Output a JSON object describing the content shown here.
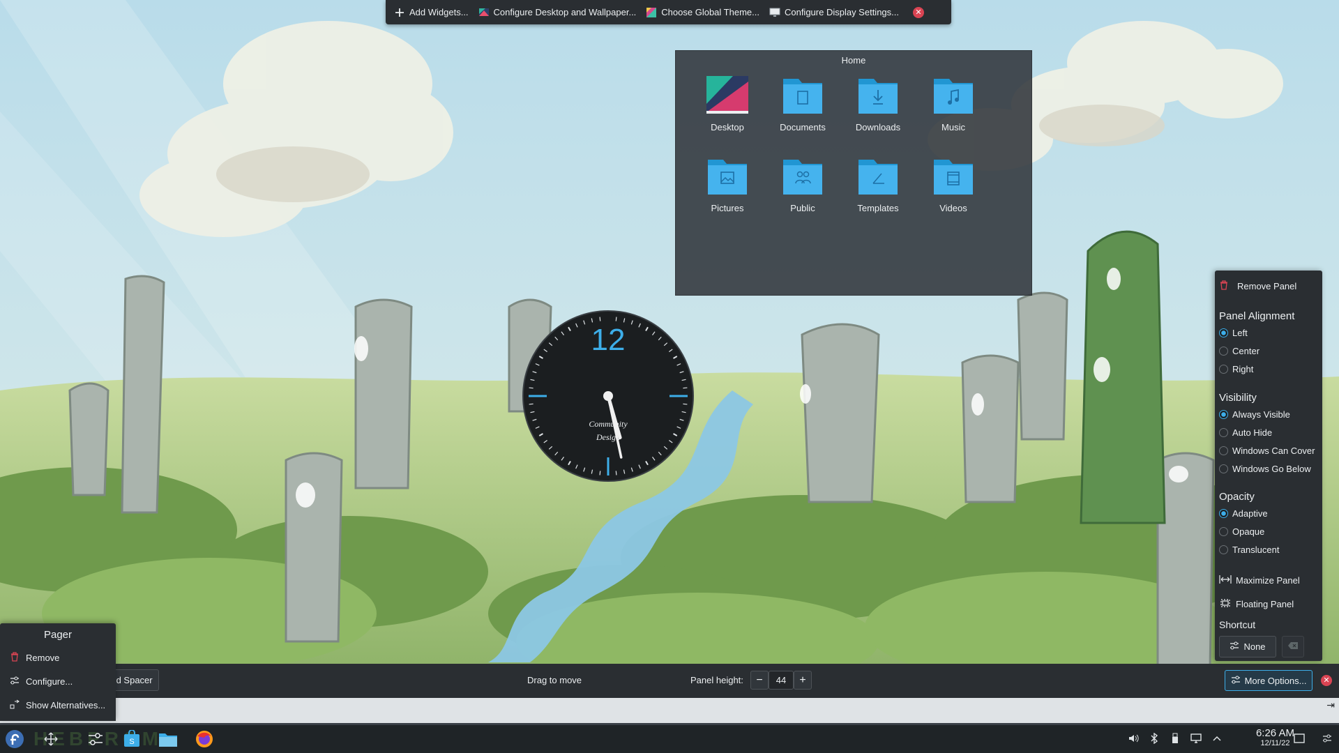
{
  "desktop_toolbar": {
    "add_widgets": "Add Widgets...",
    "configure_desktop": "Configure Desktop and Wallpaper...",
    "choose_theme": "Choose Global Theme...",
    "configure_display": "Configure Display Settings...",
    "close": "✕"
  },
  "folder_view": {
    "title": "Home",
    "items": [
      {
        "label": "Desktop",
        "icon": "desktop-folder-icon"
      },
      {
        "label": "Documents",
        "icon": "documents-folder-icon"
      },
      {
        "label": "Downloads",
        "icon": "downloads-folder-icon"
      },
      {
        "label": "Music",
        "icon": "music-folder-icon"
      },
      {
        "label": "Pictures",
        "icon": "pictures-folder-icon"
      },
      {
        "label": "Public",
        "icon": "public-folder-icon"
      },
      {
        "label": "Templates",
        "icon": "templates-folder-icon"
      },
      {
        "label": "Videos",
        "icon": "videos-folder-icon"
      }
    ]
  },
  "analog_clock": {
    "numeral": "12",
    "brand_line1": "Community",
    "brand_line2": "Design",
    "hour": 5,
    "minute": 28
  },
  "panel_options": {
    "remove_panel": "Remove Panel",
    "alignment_heading": "Panel Alignment",
    "alignment": [
      "Left",
      "Center",
      "Right"
    ],
    "alignment_selected": "Left",
    "visibility_heading": "Visibility",
    "visibility": [
      "Always Visible",
      "Auto Hide",
      "Windows Can Cover",
      "Windows Go Below"
    ],
    "visibility_selected": "Always Visible",
    "opacity_heading": "Opacity",
    "opacity": [
      "Adaptive",
      "Opaque",
      "Translucent"
    ],
    "opacity_selected": "Adaptive",
    "maximize_panel": "Maximize Panel",
    "floating_panel": "Floating Panel",
    "shortcut_heading": "Shortcut",
    "shortcut_value": "None"
  },
  "widget_menu": {
    "title": "Pager",
    "remove": "Remove",
    "configure": "Configure...",
    "show_alternatives": "Show Alternatives..."
  },
  "panel_config": {
    "add_spacer": "dd Spacer",
    "drag_to_move": "Drag to move",
    "panel_height_label": "Panel height:",
    "panel_height_value": "44",
    "minus": "−",
    "plus": "+",
    "more_options": "More Options...",
    "close": "✕"
  },
  "taskbar": {
    "watermark": "HEBPROM",
    "time": "6:26 AM",
    "date": "12/11/22"
  },
  "colors": {
    "accent": "#3daee9",
    "panel_bg": "#2a2e32",
    "close_red": "#da4453",
    "folder_blue": "#3daee9"
  }
}
